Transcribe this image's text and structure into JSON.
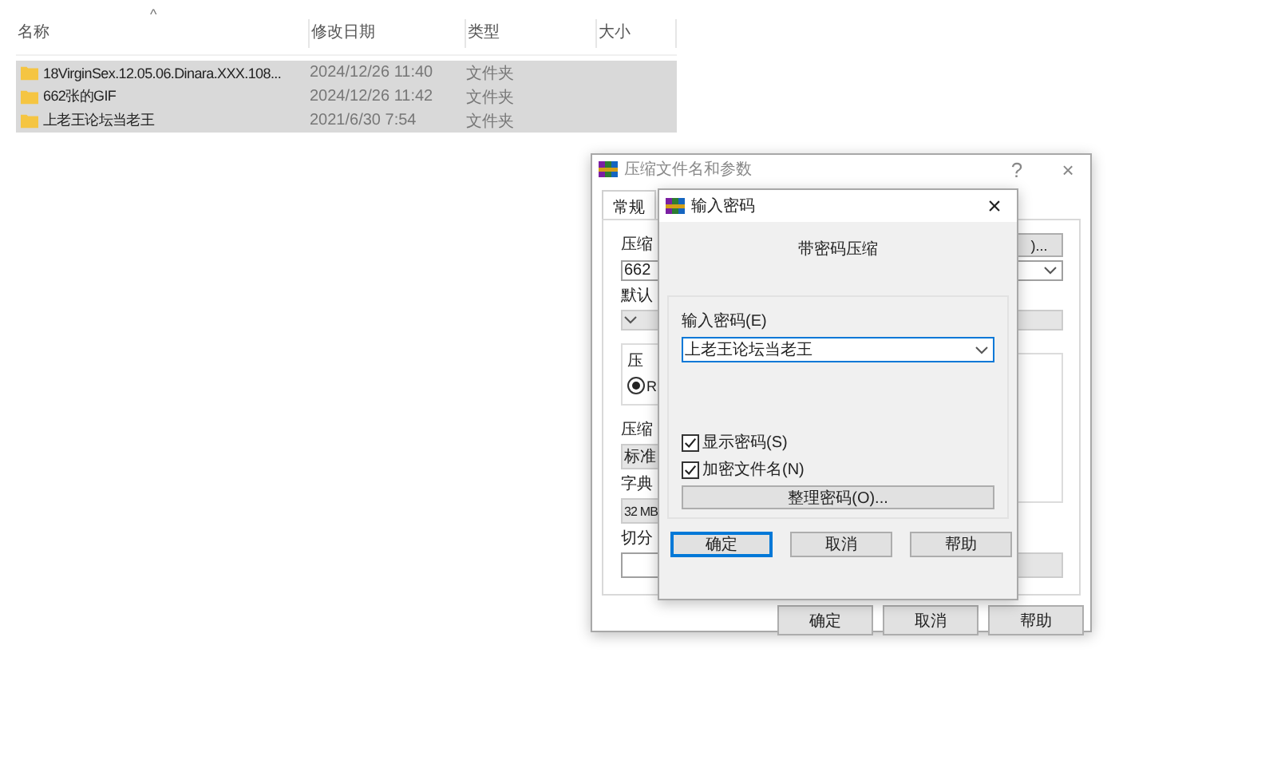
{
  "explorer": {
    "sort_indicator": "^",
    "columns": [
      "名称",
      "修改日期",
      "类型",
      "大小"
    ],
    "rows": [
      {
        "name": "18VirginSex.12.05.06.Dinara.XXX.108...",
        "modified": "2024/12/26 11:40",
        "type": "文件夹",
        "selected": true
      },
      {
        "name": "662张的GIF",
        "modified": "2024/12/26 11:42",
        "type": "文件夹",
        "selected": true
      },
      {
        "name": "上老王论坛当老王",
        "modified": "2021/6/30 7:54",
        "type": "文件夹",
        "selected": true
      }
    ]
  },
  "archive_dialog": {
    "title": "压缩文件名和参数",
    "help": "?",
    "close": "×",
    "tabs": [
      {
        "label": "常规",
        "selected": true
      }
    ],
    "archive_name_label": "压缩",
    "browse_button": ")...",
    "archive_name": "662",
    "profile_label": "默认",
    "format_group_label": "压",
    "format_option": {
      "label": "R",
      "selected": true
    },
    "method_label": "压缩",
    "method": "标准",
    "dictionary_label": "字典",
    "dictionary": "32 MB",
    "split_label": "切分",
    "buttons": [
      "确定",
      "取消",
      "帮助"
    ]
  },
  "password_dialog": {
    "title": "输入密码",
    "close": "×",
    "heading": "带密码压缩",
    "password_label": "输入密码(E)",
    "password": "上老王论坛当老王",
    "options": [
      {
        "label": "显示密码(S)",
        "checked": true
      },
      {
        "label": "加密文件名(N)",
        "checked": true
      }
    ],
    "organize_button": "整理密码(O)...",
    "buttons": [
      {
        "label": "确定",
        "default": true
      },
      {
        "label": "取消",
        "default": false
      },
      {
        "label": "帮助",
        "default": false
      }
    ]
  }
}
